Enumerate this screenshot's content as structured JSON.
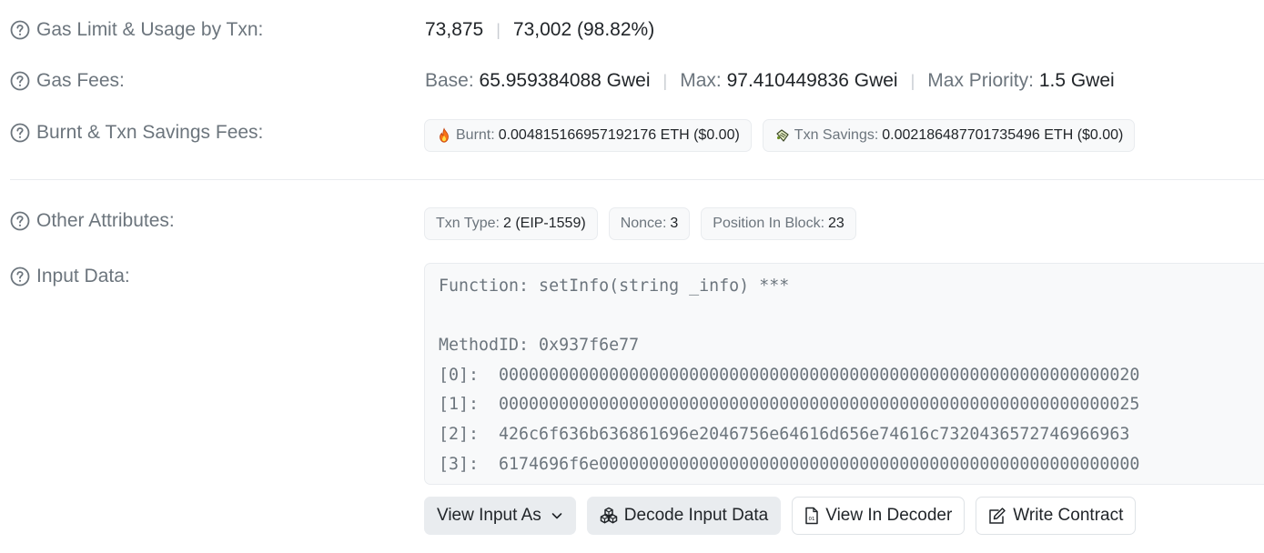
{
  "gas_limit": {
    "label": "Gas Limit & Usage by Txn:",
    "limit": "73,875",
    "usage": "73,002 (98.82%)"
  },
  "gas_fees": {
    "label": "Gas Fees:",
    "base_key": "Base:",
    "base_val": "65.959384088 Gwei",
    "max_key": "Max:",
    "max_val": "97.410449836 Gwei",
    "priority_key": "Max Priority:",
    "priority_val": "1.5 Gwei"
  },
  "burnt": {
    "label": "Burnt & Txn Savings Fees:",
    "burnt_key": "Burnt:",
    "burnt_val": "0.004815166957192176 ETH ($0.00)",
    "savings_key": "Txn Savings:",
    "savings_val": "0.002186487701735496 ETH ($0.00)"
  },
  "attributes": {
    "label": "Other Attributes:",
    "type_key": "Txn Type:",
    "type_val": "2 (EIP-1559)",
    "nonce_key": "Nonce:",
    "nonce_val": "3",
    "position_key": "Position In Block:",
    "position_val": "23"
  },
  "input": {
    "label": "Input Data:",
    "content": "Function: setInfo(string _info) ***\n\nMethodID: 0x937f6e77\n[0]:  0000000000000000000000000000000000000000000000000000000000000020\n[1]:  0000000000000000000000000000000000000000000000000000000000000025\n[2]:  426c6f636b636861696e2046756e64616d656e74616c7320436572746966963\n[3]:  6174696f6e000000000000000000000000000000000000000000000000000000"
  },
  "buttons": {
    "view_as": "View Input As",
    "decode": "Decode Input Data",
    "decoder": "View In Decoder",
    "write": "Write Contract"
  },
  "icons": {
    "help": "question-circle-icon",
    "burnt": "flame-icon",
    "savings": "savings-icon",
    "decode": "boxes-icon",
    "decoder": "document-icon",
    "write": "edit-icon",
    "chevron": "chevron-down-icon"
  },
  "colors": {
    "label": "#6c757d",
    "value": "#212529",
    "pill_bg": "#f8f9fa",
    "button_grey": "#e9ecef",
    "flame": "#f97316"
  }
}
